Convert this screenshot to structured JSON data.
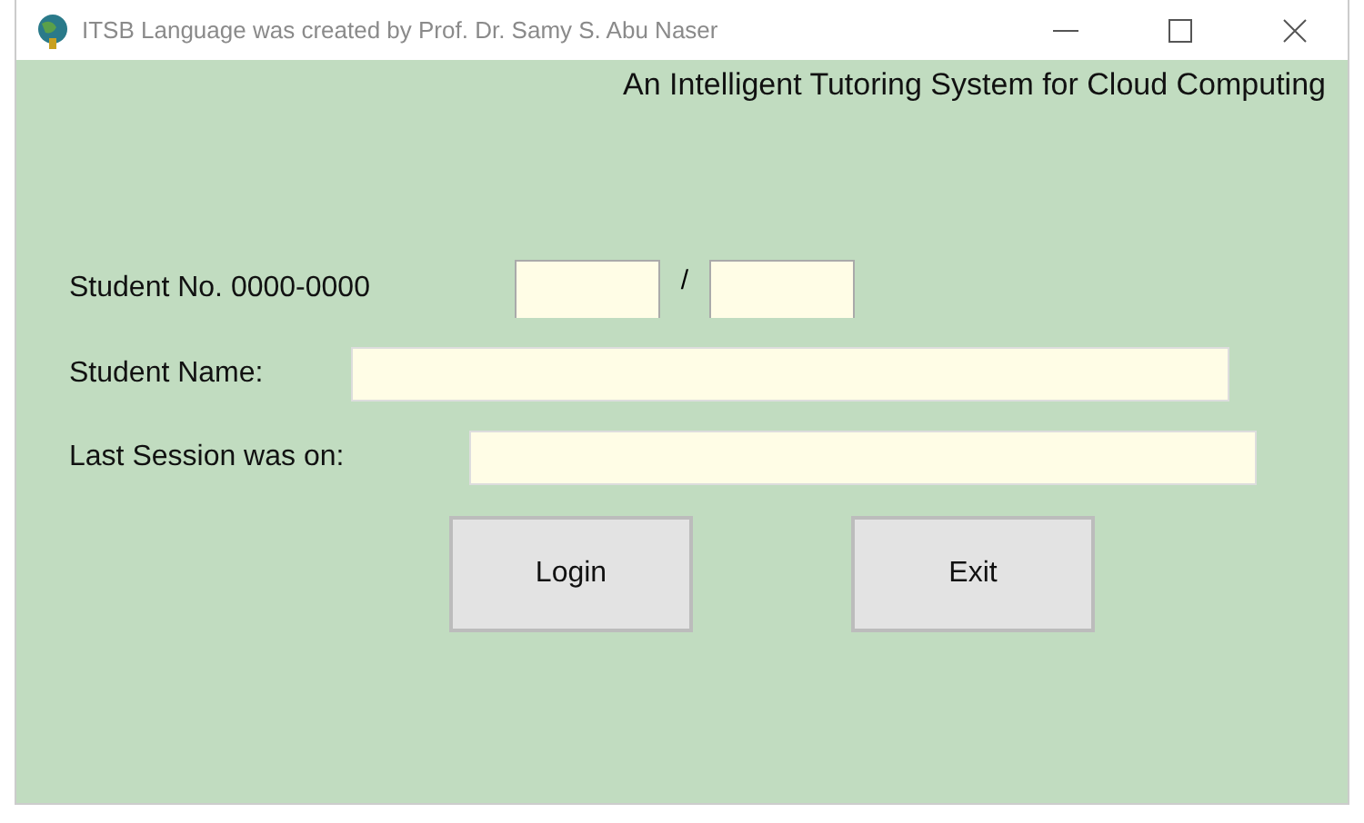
{
  "window": {
    "title": "ITSB Language was created by Prof. Dr. Samy S. Abu Naser"
  },
  "subtitle": "An Intelligent Tutoring System for Cloud Computing",
  "student_no": {
    "label": "Student No. 0000-0000",
    "separator": "/"
  },
  "student_name": {
    "label": "Student Name:"
  },
  "last_session": {
    "label": "Last Session was on:"
  },
  "buttons": [
    "Login",
    "Exit"
  ]
}
